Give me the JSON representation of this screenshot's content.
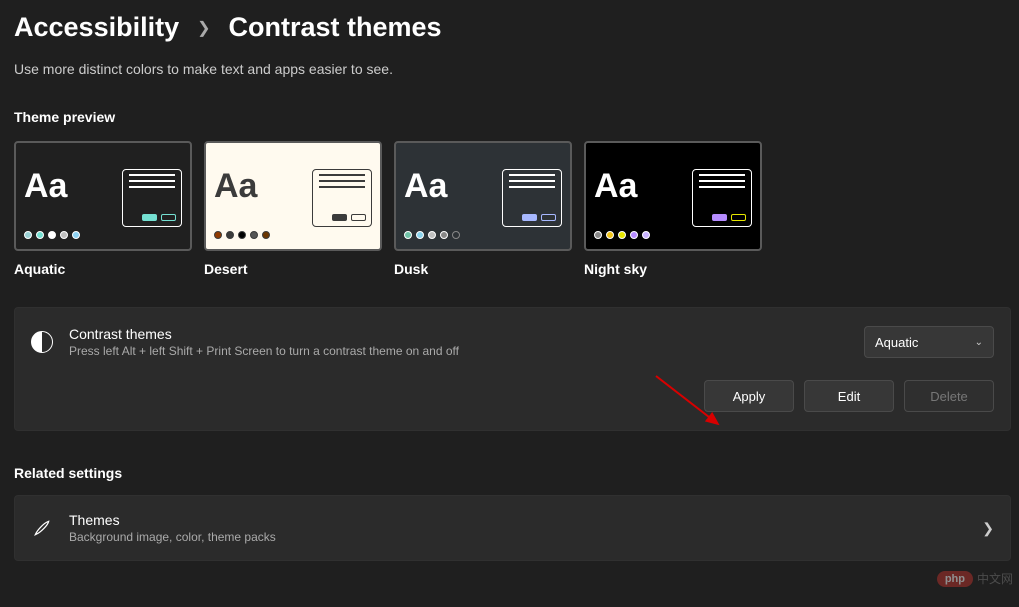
{
  "breadcrumb": {
    "parent": "Accessibility",
    "current": "Contrast themes"
  },
  "subtitle": "Use more distinct colors to make text and apps easier to see.",
  "preview_label": "Theme preview",
  "themes": {
    "aquatic": "Aquatic",
    "desert": "Desert",
    "dusk": "Dusk",
    "night": "Night sky",
    "sample": "Aa"
  },
  "panel": {
    "title": "Contrast themes",
    "sub": "Press left Alt + left Shift + Print Screen to turn a contrast theme on and off",
    "selected": "Aquatic",
    "apply": "Apply",
    "edit": "Edit",
    "delete": "Delete"
  },
  "related": {
    "label": "Related settings",
    "title": "Themes",
    "sub": "Background image, color, theme packs"
  },
  "watermark": {
    "badge": "php",
    "txt": "中文网"
  }
}
